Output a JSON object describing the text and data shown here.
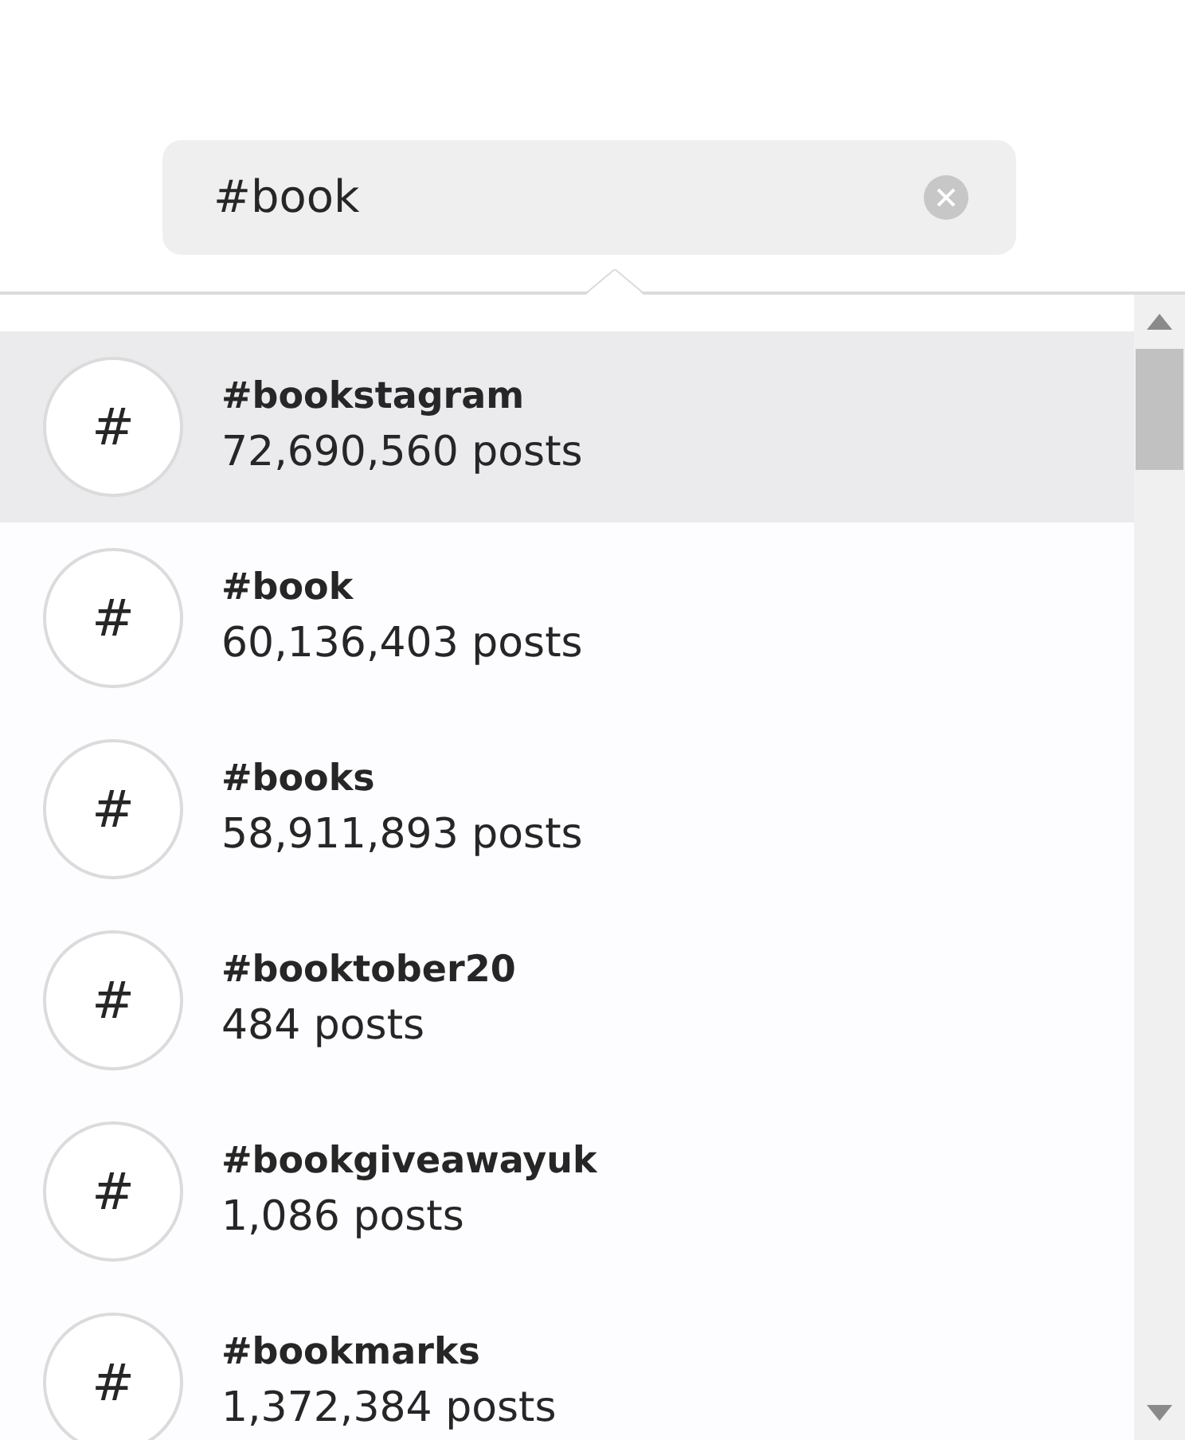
{
  "search": {
    "value": "#book"
  },
  "results": [
    {
      "icon": "#",
      "tag": "#bookstagram",
      "count": "72,690,560 posts",
      "selected": true
    },
    {
      "icon": "#",
      "tag": "#book",
      "count": "60,136,403 posts",
      "selected": false
    },
    {
      "icon": "#",
      "tag": "#books",
      "count": "58,911,893 posts",
      "selected": false
    },
    {
      "icon": "#",
      "tag": "#booktober20",
      "count": "484 posts",
      "selected": false
    },
    {
      "icon": "#",
      "tag": "#bookgiveawayuk",
      "count": "1,086 posts",
      "selected": false
    },
    {
      "icon": "#",
      "tag": "#bookmarks",
      "count": "1,372,384 posts",
      "selected": false
    }
  ]
}
